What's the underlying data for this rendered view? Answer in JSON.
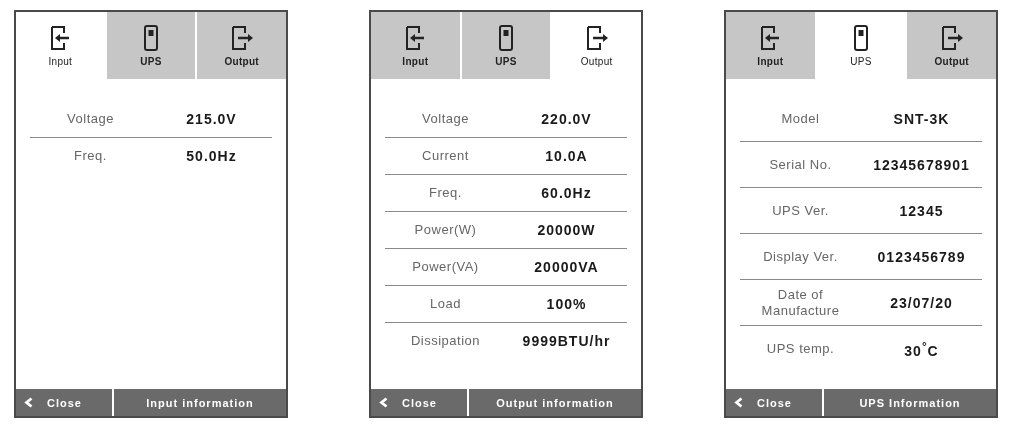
{
  "panels": [
    {
      "tabs": [
        {
          "kind": "input",
          "label": "Input",
          "selected": true
        },
        {
          "kind": "ups",
          "label": "UPS",
          "selected": false
        },
        {
          "kind": "output",
          "label": "Output",
          "selected": false
        }
      ],
      "rows": [
        {
          "label": "Voltage",
          "value": "215.0V"
        },
        {
          "label": "Freq.",
          "value": "50.0Hz"
        }
      ],
      "footer": {
        "close": "Close",
        "title": "Input information"
      }
    },
    {
      "tabs": [
        {
          "kind": "input",
          "label": "Input",
          "selected": false
        },
        {
          "kind": "ups",
          "label": "UPS",
          "selected": false
        },
        {
          "kind": "output",
          "label": "Output",
          "selected": true
        }
      ],
      "rows": [
        {
          "label": "Voltage",
          "value": "220.0V"
        },
        {
          "label": "Current",
          "value": "10.0A"
        },
        {
          "label": "Freq.",
          "value": "60.0Hz"
        },
        {
          "label": "Power(W)",
          "value": "20000W"
        },
        {
          "label": "Power(VA)",
          "value": "20000VA"
        },
        {
          "label": "Load",
          "value": "100%"
        },
        {
          "label": "Dissipation",
          "value": "9999BTU/hr"
        }
      ],
      "footer": {
        "close": "Close",
        "title": "Output information"
      }
    },
    {
      "tabs": [
        {
          "kind": "input",
          "label": "Input",
          "selected": false
        },
        {
          "kind": "ups",
          "label": "UPS",
          "selected": true
        },
        {
          "kind": "output",
          "label": "Output",
          "selected": false
        }
      ],
      "rows": [
        {
          "label": "Model",
          "value": "SNT-3K"
        },
        {
          "label": "Serial No.",
          "value": "12345678901"
        },
        {
          "label": "UPS Ver.",
          "value": "12345"
        },
        {
          "label": "Display Ver.",
          "value": "0123456789"
        },
        {
          "label": "Date of Manufacture",
          "value": "23/07/20"
        },
        {
          "label": "UPS temp.",
          "value": "30$^{°}$C"
        }
      ],
      "footer": {
        "close": "Close",
        "title": "UPS Information"
      }
    }
  ]
}
